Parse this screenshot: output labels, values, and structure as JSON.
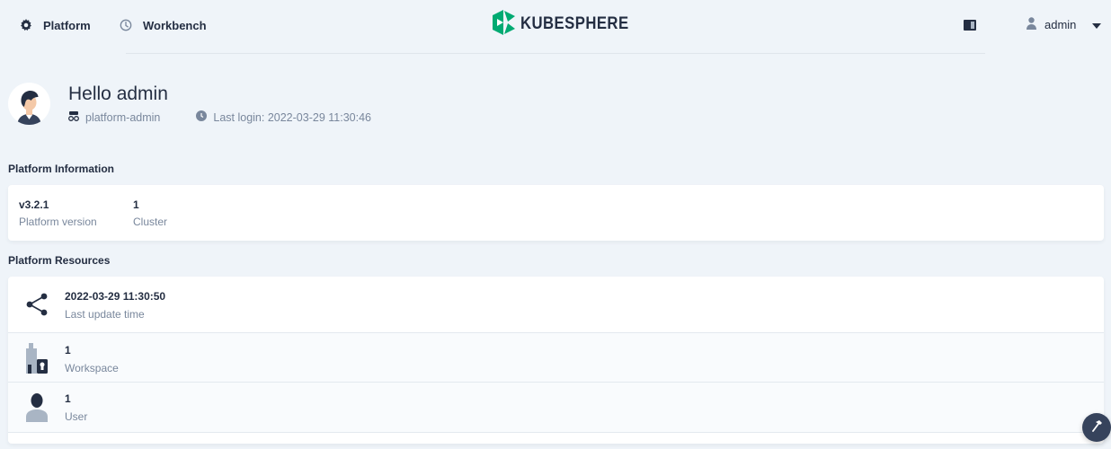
{
  "header": {
    "nav": [
      {
        "label": "Platform",
        "icon": "gear-icon"
      },
      {
        "label": "Workbench",
        "icon": "dashboard-icon"
      }
    ],
    "logo_text": "KUBESPHERE",
    "user": {
      "name": "admin"
    }
  },
  "greeting": {
    "title": "Hello admin",
    "role": "platform-admin",
    "last_login": "Last login: 2022-03-29 11:30:46"
  },
  "platform_info": {
    "title": "Platform Information",
    "stats": [
      {
        "value": "v3.2.1",
        "label": "Platform version"
      },
      {
        "value": "1",
        "label": "Cluster"
      }
    ]
  },
  "platform_resources": {
    "title": "Platform Resources",
    "rows": [
      {
        "value": "2022-03-29 11:30:50",
        "label": "Last update time",
        "icon": "share-nodes-icon"
      },
      {
        "value": "1",
        "label": "Workspace",
        "icon": "workspace-icon"
      },
      {
        "value": "1",
        "label": "User",
        "icon": "user-icon"
      }
    ]
  },
  "colors": {
    "background": "#eff4f9",
    "brand_green": "#00aa72",
    "text_primary": "#242e42",
    "text_secondary": "#79879c"
  }
}
